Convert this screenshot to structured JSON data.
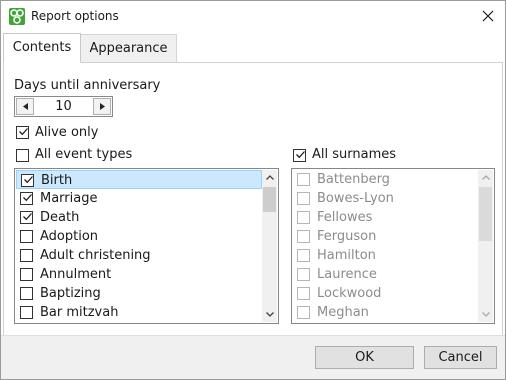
{
  "window": {
    "title": "Report options"
  },
  "tabs": [
    {
      "label": "Contents",
      "active": true
    },
    {
      "label": "Appearance",
      "active": false
    }
  ],
  "contents": {
    "days_label": "Days until anniversary",
    "days_value": "10",
    "alive_only": {
      "label": "Alive only",
      "checked": true
    },
    "all_event_types": {
      "label": "All event types",
      "checked": false
    },
    "all_surnames": {
      "label": "All surnames",
      "checked": true
    },
    "event_types": [
      {
        "label": "Birth",
        "checked": true,
        "selected": true
      },
      {
        "label": "Marriage",
        "checked": true,
        "selected": false
      },
      {
        "label": "Death",
        "checked": true,
        "selected": false
      },
      {
        "label": "Adoption",
        "checked": false,
        "selected": false
      },
      {
        "label": "Adult christening",
        "checked": false,
        "selected": false
      },
      {
        "label": "Annulment",
        "checked": false,
        "selected": false
      },
      {
        "label": "Baptizing",
        "checked": false,
        "selected": false
      },
      {
        "label": "Bar mitzvah",
        "checked": false,
        "selected": false
      }
    ],
    "surnames": [
      {
        "label": "Battenberg",
        "checked": false
      },
      {
        "label": "Bowes-Lyon",
        "checked": false
      },
      {
        "label": "Fellowes",
        "checked": false
      },
      {
        "label": "Ferguson",
        "checked": false
      },
      {
        "label": "Hamilton",
        "checked": false
      },
      {
        "label": "Laurence",
        "checked": false
      },
      {
        "label": "Lockwood",
        "checked": false
      },
      {
        "label": "Meghan",
        "checked": false
      }
    ]
  },
  "buttons": {
    "ok": "OK",
    "cancel": "Cancel"
  },
  "colors": {
    "selection_bg": "#cce8ff",
    "selection_border": "#99d1ff",
    "app_icon": "#3fa535"
  },
  "icons": {
    "app": "genealogy-tree-icon",
    "close": "close-icon"
  }
}
